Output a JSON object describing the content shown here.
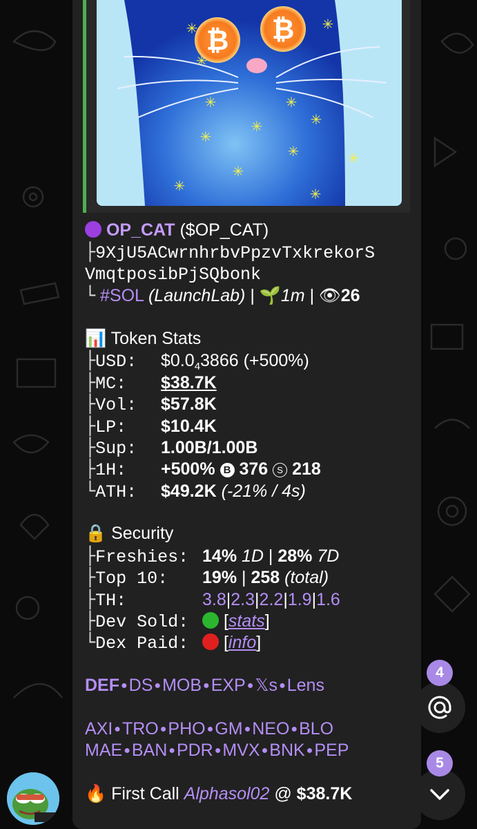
{
  "token": {
    "name": "OP_CAT",
    "ticker": "($OP_CAT)",
    "address_line1": "9XjU5ACwrnhrbvPpzvTxkrekorS",
    "address_line2": "VmqtposibPjSQbonk",
    "chain": "#SOL",
    "launchpad": "(LaunchLab)",
    "age": "1m",
    "views": "26"
  },
  "stats": {
    "title": "Token Stats",
    "usd_label": "USD:",
    "usd_value_prefix": "$0.0",
    "usd_value_sub": "4",
    "usd_value_rest": "3866",
    "usd_change": "(+500%)",
    "mc_label": "MC:",
    "mc_value": "$38.7K",
    "vol_label": "Vol:",
    "vol_value": "$57.8K",
    "lp_label": "LP:",
    "lp_value": "$10.4K",
    "sup_label": "Sup:",
    "sup_value": "1.00B/1.00B",
    "h1_label": "1H:",
    "h1_change": "+500%",
    "h1_buy_letter": "B",
    "h1_buys": "376",
    "h1_sell_letter": "S",
    "h1_sells": "218",
    "ath_label": "ATH:",
    "ath_value": "$49.2K",
    "ath_detail": "(-21% / 4s)"
  },
  "security": {
    "title": "Security",
    "freshies_label": "Freshies:",
    "freshies_1d": "14%",
    "freshies_1d_unit": "1D",
    "freshies_7d": "28%",
    "freshies_7d_unit": "7D",
    "top10_label": "Top 10:",
    "top10_pct": "19%",
    "top10_total": "258",
    "top10_total_note": "(total)",
    "th_label": "TH:",
    "th_values": [
      "3.8",
      "2.3",
      "2.2",
      "1.9",
      "1.6"
    ],
    "dev_sold_label": "Dev Sold:",
    "dev_sold_link": "stats",
    "dev_sold_color": "#2bb52f",
    "dex_paid_label": "Dex Paid:",
    "dex_paid_link": "info",
    "dex_paid_color": "#e0201e"
  },
  "links_row1": [
    "DEF",
    "DS",
    "MOB",
    "EXP",
    "𝕏s",
    "Lens"
  ],
  "links_row2": [
    "AXI",
    "TRO",
    "PHO",
    "GM",
    "NEO",
    "BLO"
  ],
  "links_row3": [
    "MAE",
    "BAN",
    "PDR",
    "MVX",
    "BNK",
    "PEP"
  ],
  "first_call": {
    "label": "First Call",
    "caller": "Alphasol02",
    "at": "@",
    "mc": "$38.7K"
  },
  "fabs": {
    "mentions_count": "4",
    "unread_count": "5"
  },
  "icons": {
    "token": "purple-circle-icon",
    "stats": "bar-chart-icon",
    "security": "lock-icon",
    "age": "seedling-icon",
    "views": "eye-icon",
    "first_call": "fire-icon",
    "mention": "at-sign-icon",
    "scroll": "chevron-down-icon"
  }
}
